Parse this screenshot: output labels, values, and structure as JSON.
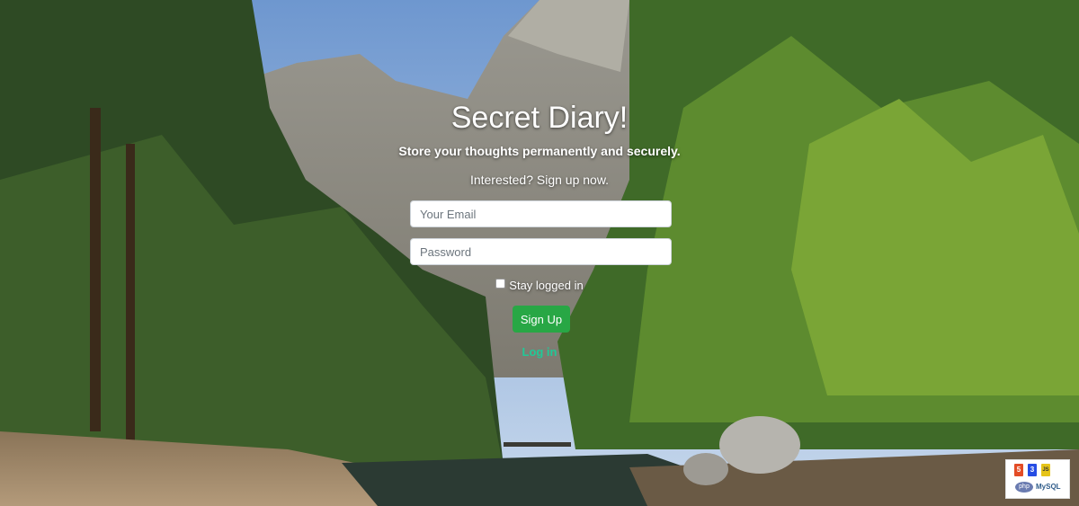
{
  "title": "Secret Diary!",
  "subtitle": "Store your thoughts permanently and securely.",
  "prompt": "Interested? Sign up now.",
  "form": {
    "email_placeholder": "Your Email",
    "password_placeholder": "Password",
    "stay_logged_in_label": "Stay logged in",
    "signup_label": "Sign Up",
    "login_link": "Log in"
  },
  "badge": {
    "html_label": "5",
    "css_label": "3",
    "js_label": "JS",
    "php_label": "php",
    "mysql_label": "MySQL"
  },
  "colors": {
    "signup_button": "#28a745",
    "login_link": "#20c997"
  }
}
